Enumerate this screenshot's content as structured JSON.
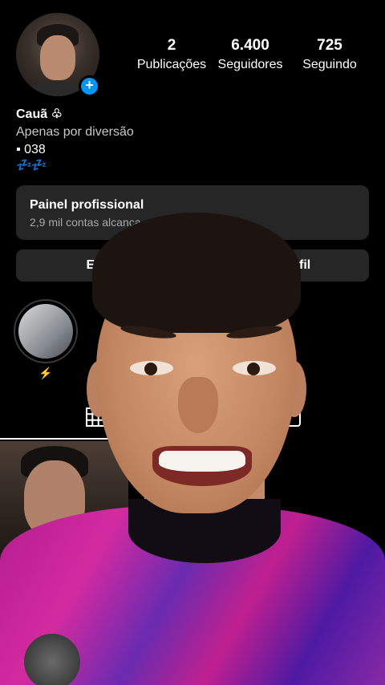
{
  "profile": {
    "name": "Cauã",
    "name_symbol": "♧",
    "bio_line1": "Apenas por diversão",
    "bio_line2": "▪ 038",
    "bio_line3": "💤💤",
    "add_story_icon": "plus-icon"
  },
  "stats": [
    {
      "value": "2",
      "label": "Publicações"
    },
    {
      "value": "6.400",
      "label": "Seguidores"
    },
    {
      "value": "725",
      "label": "Seguindo"
    }
  ],
  "professional_panel": {
    "title": "Painel profissional",
    "subtitle": "2,9 mil contas alcança… 30 dias."
  },
  "buttons": {
    "edit": "Edita",
    "share": "har perfil"
  },
  "highlight": {
    "label": "⚡"
  },
  "tabs": {
    "grid_icon": "grid-icon",
    "tagged_icon": "tagged-icon"
  },
  "colors": {
    "background": "#000000",
    "accent_blue": "#0095f6",
    "panel": "#262626"
  }
}
